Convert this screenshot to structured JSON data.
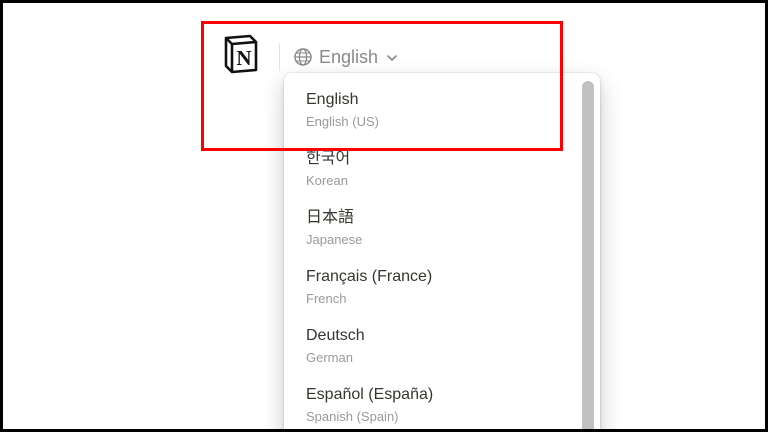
{
  "header": {
    "logo_letter": "N",
    "language_label": "English"
  },
  "dropdown": {
    "options": [
      {
        "native": "English",
        "english": "English (US)"
      },
      {
        "native": "한국어",
        "english": "Korean"
      },
      {
        "native": "日本語",
        "english": "Japanese"
      },
      {
        "native": "Français (France)",
        "english": "French"
      },
      {
        "native": "Deutsch",
        "english": "German"
      },
      {
        "native": "Español (España)",
        "english": "Spanish (Spain)"
      }
    ]
  },
  "icons": {
    "logo": "notion-logo-icon",
    "globe": "globe-icon",
    "chevron": "chevron-down-icon"
  },
  "colors": {
    "highlight": "#ff0000",
    "text_primary": "#37352f",
    "text_secondary": "#9b9a97",
    "trigger_text": "#8a8a88"
  }
}
